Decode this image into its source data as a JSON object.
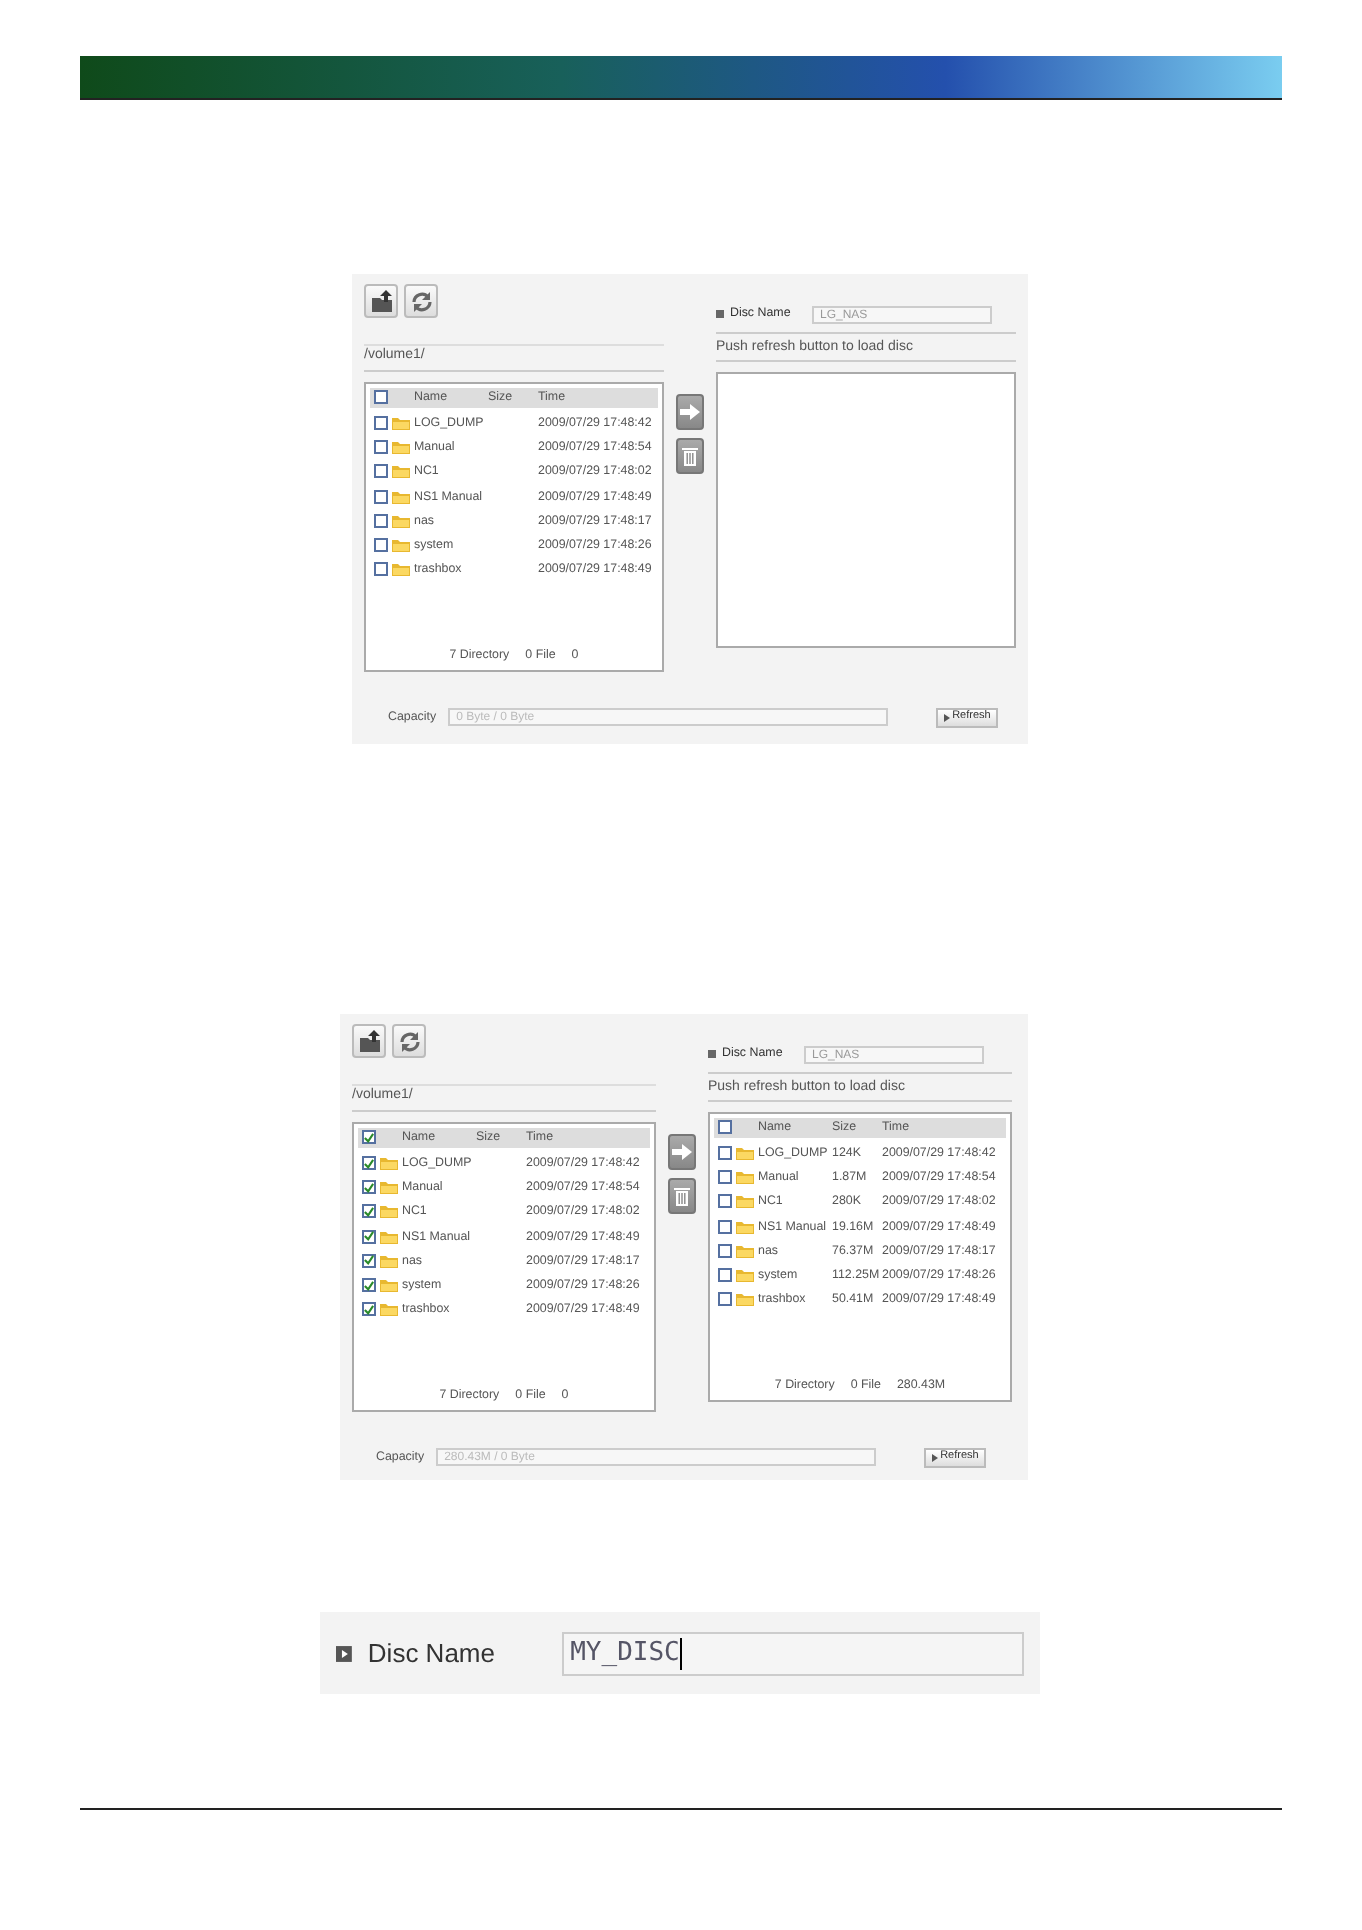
{
  "panels": [
    {
      "kind": "transfer",
      "disc_label": "Disc Name",
      "disc_name": "LG_NAS",
      "path": "/volume1/",
      "hint": "Push refresh button to load disc",
      "source": {
        "all_checked": false,
        "columns": [
          "Name",
          "Size",
          "Time"
        ],
        "rows": [
          {
            "name": "LOG_DUMP",
            "size": "",
            "time": "2009/07/29 17:48:42",
            "checked": false
          },
          {
            "name": "Manual",
            "size": "",
            "time": "2009/07/29 17:48:54",
            "checked": false
          },
          {
            "name": "NC1",
            "size": "",
            "time": "2009/07/29 17:48:02",
            "checked": false
          },
          {
            "name": "NS1 Manual",
            "size": "",
            "time": "2009/07/29 17:48:49",
            "checked": false
          },
          {
            "name": "nas",
            "size": "",
            "time": "2009/07/29 17:48:17",
            "checked": false
          },
          {
            "name": "system",
            "size": "",
            "time": "2009/07/29 17:48:26",
            "checked": false
          },
          {
            "name": "trashbox",
            "size": "",
            "time": "2009/07/29 17:48:49",
            "checked": false
          }
        ],
        "summary": [
          "7 Directory",
          "0 File",
          "0"
        ]
      },
      "capacity_label": "Capacity",
      "capacity": "0 Byte / 0 Byte",
      "refresh": "Refresh"
    },
    {
      "kind": "transfer",
      "disc_label": "Disc Name",
      "disc_name": "LG_NAS",
      "path": "/volume1/",
      "hint": "Push refresh button to load disc",
      "source": {
        "all_checked": true,
        "columns": [
          "Name",
          "Size",
          "Time"
        ],
        "rows": [
          {
            "name": "LOG_DUMP",
            "size": "",
            "time": "2009/07/29 17:48:42",
            "checked": true
          },
          {
            "name": "Manual",
            "size": "",
            "time": "2009/07/29 17:48:54",
            "checked": true
          },
          {
            "name": "NC1",
            "size": "",
            "time": "2009/07/29 17:48:02",
            "checked": true
          },
          {
            "name": "NS1 Manual",
            "size": "",
            "time": "2009/07/29 17:48:49",
            "checked": true
          },
          {
            "name": "nas",
            "size": "",
            "time": "2009/07/29 17:48:17",
            "checked": true
          },
          {
            "name": "system",
            "size": "",
            "time": "2009/07/29 17:48:26",
            "checked": true
          },
          {
            "name": "trashbox",
            "size": "",
            "time": "2009/07/29 17:48:49",
            "checked": true
          }
        ],
        "summary": [
          "7 Directory",
          "0 File",
          "0"
        ]
      },
      "target": {
        "all_checked": false,
        "columns": [
          "Name",
          "Size",
          "Time"
        ],
        "rows": [
          {
            "name": "LOG_DUMP",
            "size": "124K",
            "time": "2009/07/29 17:48:42",
            "checked": false
          },
          {
            "name": "Manual",
            "size": "1.87M",
            "time": "2009/07/29 17:48:54",
            "checked": false
          },
          {
            "name": "NC1",
            "size": "280K",
            "time": "2009/07/29 17:48:02",
            "checked": false
          },
          {
            "name": "NS1 Manual",
            "size": "19.16M",
            "time": "2009/07/29 17:48:49",
            "checked": false
          },
          {
            "name": "nas",
            "size": "76.37M",
            "time": "2009/07/29 17:48:17",
            "checked": false
          },
          {
            "name": "system",
            "size": "112.25M",
            "time": "2009/07/29 17:48:26",
            "checked": false
          },
          {
            "name": "trashbox",
            "size": "50.41M",
            "time": "2009/07/29 17:48:49",
            "checked": false
          }
        ],
        "summary": [
          "7 Directory",
          "0 File",
          "280.43M"
        ]
      },
      "capacity_label": "Capacity",
      "capacity": "280.43M / 0 Byte",
      "refresh": "Refresh"
    },
    {
      "kind": "disc_name",
      "label": "Disc Name",
      "value": "MY_DISC"
    }
  ]
}
